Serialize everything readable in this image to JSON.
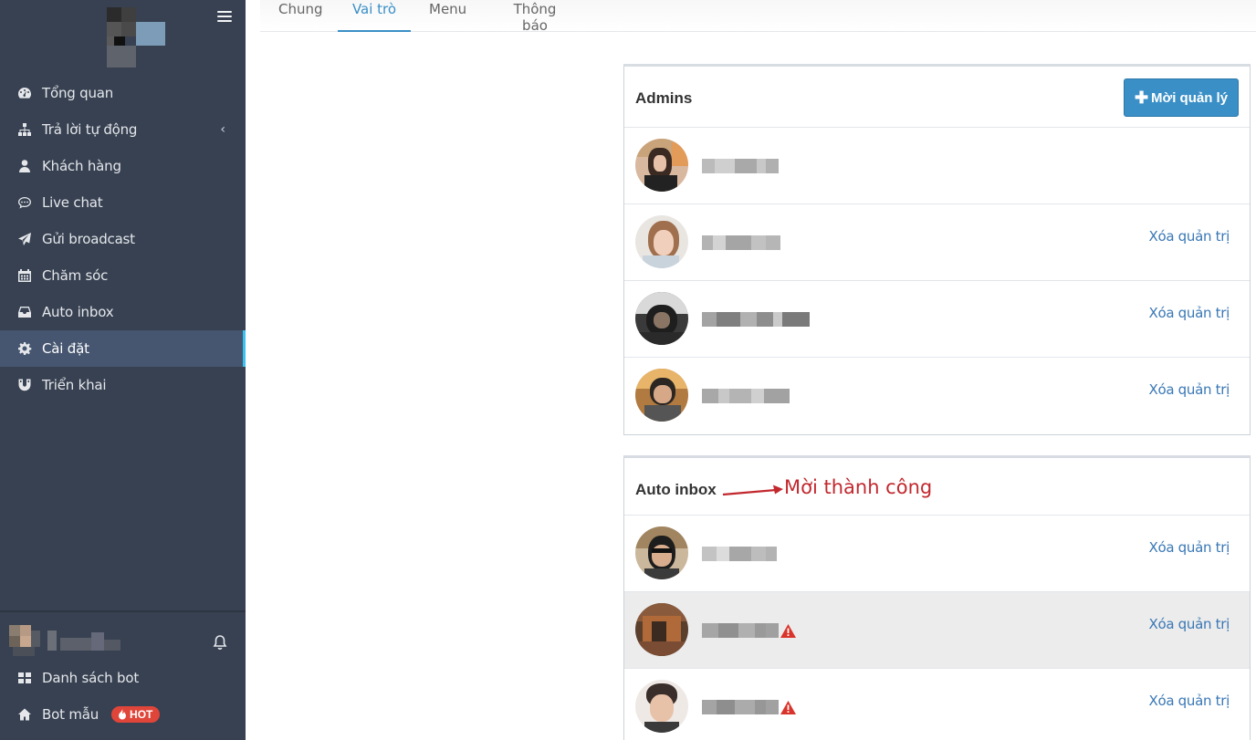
{
  "sidebar": {
    "items": [
      {
        "label": "Tổng quan",
        "icon": "dashboard-icon"
      },
      {
        "label": "Trả lời tự động",
        "icon": "sitemap-icon"
      },
      {
        "label": "Khách hàng",
        "icon": "user-icon"
      },
      {
        "label": "Live chat",
        "icon": "chat-icon"
      },
      {
        "label": "Gửi broadcast",
        "icon": "send-icon"
      },
      {
        "label": "Chăm sóc",
        "icon": "calendar-icon"
      },
      {
        "label": "Auto inbox",
        "icon": "inbox-icon"
      },
      {
        "label": "Cài đặt",
        "icon": "gear-icon"
      },
      {
        "label": "Triển khai",
        "icon": "magnet-icon"
      }
    ],
    "active_index": 7,
    "bottom_items": [
      {
        "label": "Danh sách bot",
        "icon": "grid-icon"
      },
      {
        "label": "Bot mẫu",
        "icon": "home-icon",
        "badge": "HOT"
      }
    ]
  },
  "tabs": [
    {
      "label": "Chung"
    },
    {
      "label": "Vai trò"
    },
    {
      "label": "Menu"
    },
    {
      "label": "Thông báo"
    }
  ],
  "active_tab": 1,
  "admins": {
    "title": "Admins",
    "invite_label": "Mời quản lý",
    "remove_label": "Xóa quản trị"
  },
  "auto_inbox": {
    "title": "Auto inbox",
    "remove_label": "Xóa quản trị"
  },
  "annotation": "Mời thành công",
  "colors": {
    "sidebar_bg": "#374151",
    "accent": "#3a8fc7",
    "active_indicator": "#3bc1f0",
    "warning": "#d9342b",
    "annotation": "#c2282e"
  }
}
